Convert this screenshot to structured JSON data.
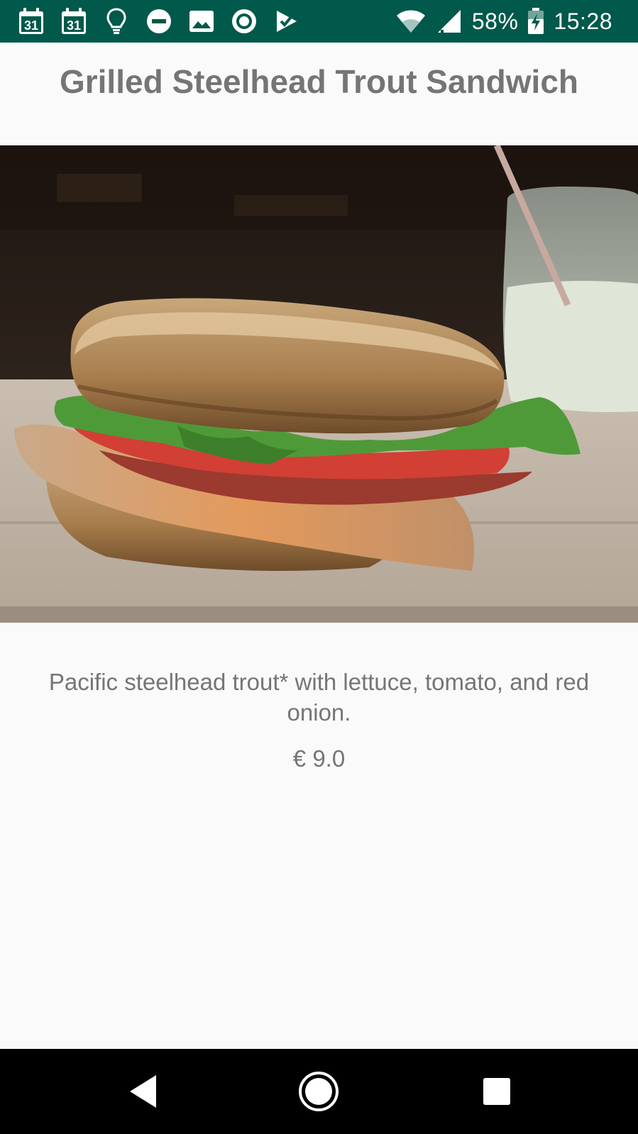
{
  "status_bar": {
    "calendar_day_1": "31",
    "calendar_day_2": "31",
    "battery_percent": "58%",
    "clock": "15:28"
  },
  "item": {
    "title": "Grilled Steelhead Trout Sandwich",
    "description": "Pacific steelhead trout* with lettuce, tomato, and red onion.",
    "price": "€ 9.0"
  },
  "colors": {
    "status_bar": "#00594a",
    "text": "#757575",
    "background": "#fafafa",
    "nav_bar": "#000000"
  },
  "icons": [
    "calendar-icon",
    "calendar-icon",
    "lightbulb-icon",
    "do-not-disturb-icon",
    "image-icon",
    "record-icon",
    "check-flag-icon",
    "wifi-icon",
    "signal-icon",
    "battery-charging-icon",
    "back-icon",
    "home-icon",
    "recents-icon"
  ]
}
